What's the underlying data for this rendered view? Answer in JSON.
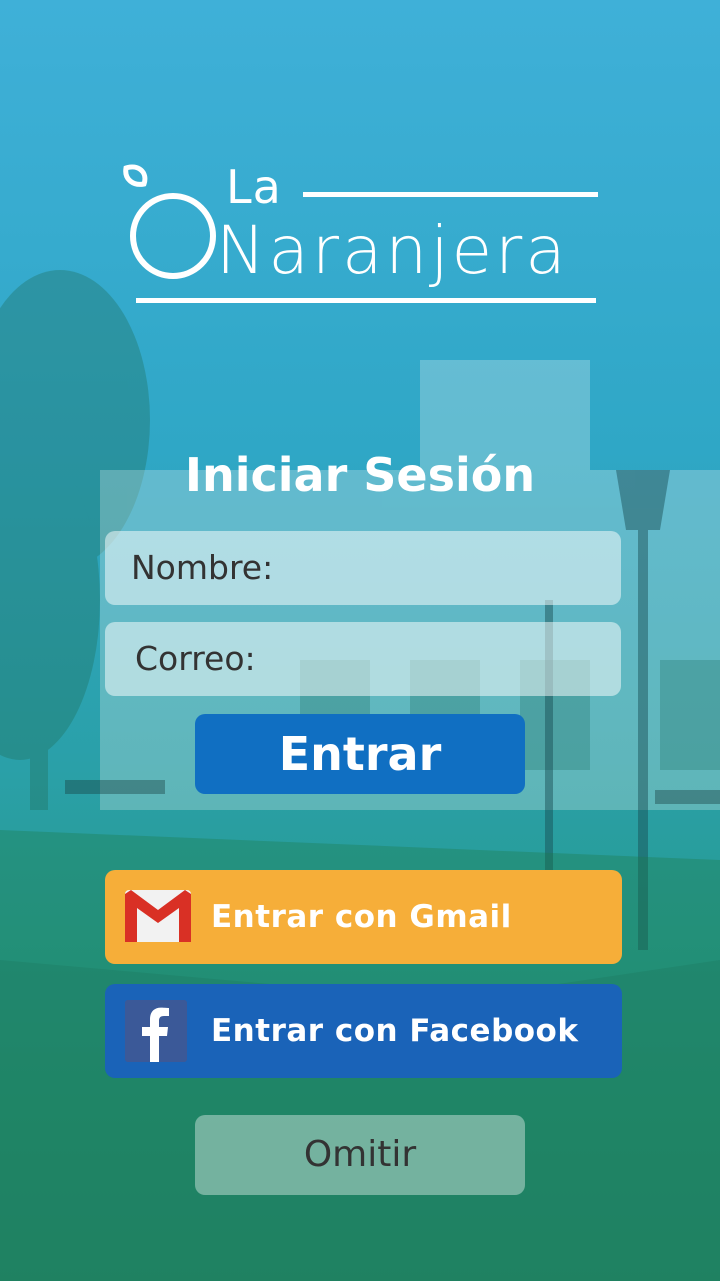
{
  "logo": {
    "line1": "La",
    "line2": "Naranjera"
  },
  "login": {
    "title": "Iniciar Sesión",
    "name_placeholder": "Nombre:",
    "email_placeholder": "Correo:",
    "submit_label": "Entrar"
  },
  "social": {
    "gmail_label": "Entrar con Gmail",
    "gmail_icon": "gmail-icon",
    "facebook_label": "Entrar con Facebook",
    "facebook_icon": "facebook-icon"
  },
  "skip_label": "Omitir",
  "colors": {
    "overlay": "#2fa7c6",
    "entrar_button": "#106fc2",
    "gmail_button": "#f6ae39",
    "facebook_button": "#1a63b8"
  }
}
